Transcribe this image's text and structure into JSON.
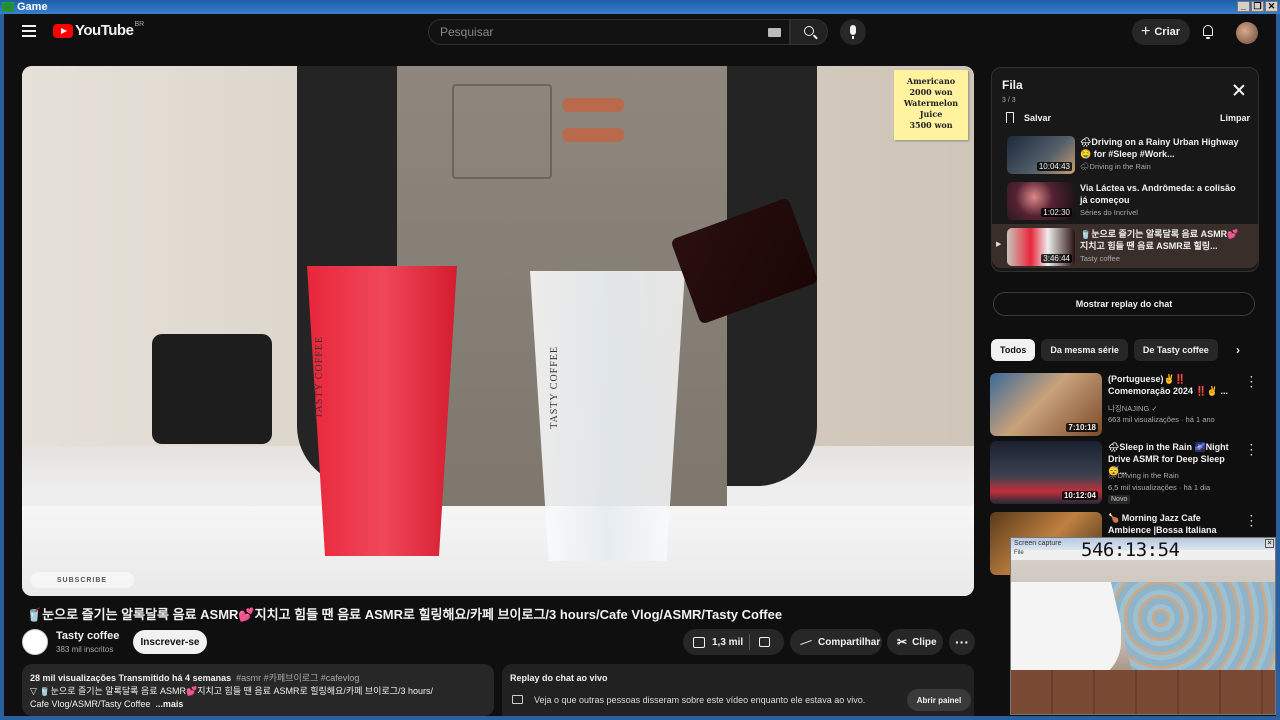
{
  "window": {
    "title": "Game",
    "buttons": [
      "_",
      "❐",
      "✕"
    ]
  },
  "header": {
    "logo_text": "YouTube",
    "country_code": "BR",
    "search_placeholder": "Pesquisar",
    "create_label": "Criar"
  },
  "video": {
    "note_lines": [
      "Americano",
      "2000 won",
      "Watermelon",
      "Juice",
      "3500 won"
    ],
    "cup_label": "TASTY COFFEE",
    "watermark": "SUBSCRIBE"
  },
  "watch": {
    "title": "🥤눈으로 즐기는 알록달록 음료 ASMR💕지치고 힘들 땐 음료 ASMR로 힐링해요/카페 브이로그/3 hours/Cafe Vlog/ASMR/Tasty Coffee",
    "channel_name": "Tasty coffee",
    "subscribers": "383 mil inscritos",
    "subscribe_label": "Inscrever-se",
    "likes": "1,3 mil",
    "share_label": "Compartilhar",
    "clip_label": "Clipe",
    "more_label": "···"
  },
  "description": {
    "stats": "28 mil visualizações  Transmitido há 4 semanas",
    "tags": "#asmr #카페브이로그 #cafevlog",
    "line1": "▽ 🥤눈으로 즐기는 알록달록 음료 ASMR💕지치고 힘들 땐 음료 ASMR로 힐링해요/카페 브이로그/3 hours/",
    "line2": "Cafe Vlog/ASMR/Tasty Coffee",
    "more": "...mais"
  },
  "chat_replay": {
    "header": "Replay do chat ao vivo",
    "text": "Veja o que outras pessoas disseram sobre este vídeo enquanto ele estava ao vivo.",
    "button": "Abrir painel"
  },
  "queue": {
    "title": "Fila",
    "count": "3 / 3",
    "save_label": "Salvar",
    "clear_label": "Limpar",
    "items": [
      {
        "title": "🌧Driving on a Rainy Urban Highway 🤤 for #Sleep #Work...",
        "channel": "🌧Driving in the Rain",
        "duration": "10:04:43"
      },
      {
        "title": "Via Láctea vs. Andrômeda: a colisão já começou",
        "channel": "Séries do Incrível",
        "duration": "1:02:30"
      },
      {
        "title": "🥤눈으로 즐기는 알록달록 음료 ASMR💕지치고 힘들 땐 음료 ASMR로 힐링...",
        "channel": "Tasty coffee",
        "duration": "3:46:44",
        "playing_mark": "▶"
      }
    ]
  },
  "sidebar": {
    "chat_button": "Mostrar replay do chat",
    "chips": [
      "Todos",
      "Da mesma série",
      "De Tasty coffee"
    ],
    "chip_next": "›",
    "recommendations": [
      {
        "title": "(Portuguese)✌️‼️ Comemoração 2024 ‼️✌️ ...",
        "channel": "나징NAJING ✓",
        "meta": "663 mil visualizações · há 1 ano",
        "duration": "7:10:18"
      },
      {
        "title": "🌧Sleep in the Rain 🌌Night Drive ASMR for Deep Sleep 😴...",
        "channel": "🌧Driving in the Rain",
        "meta": "6,5 mil visualizações · há 1 dia",
        "duration": "10:12:04",
        "badge": "Novo"
      },
      {
        "title": "🍗 Morning Jazz Cafe Ambience |Bossa Italiana Nov...",
        "channel": "",
        "meta": "",
        "duration": ""
      }
    ]
  },
  "overlay": {
    "title": "Screen capture",
    "menu": "File",
    "counter": "546:13:54"
  }
}
